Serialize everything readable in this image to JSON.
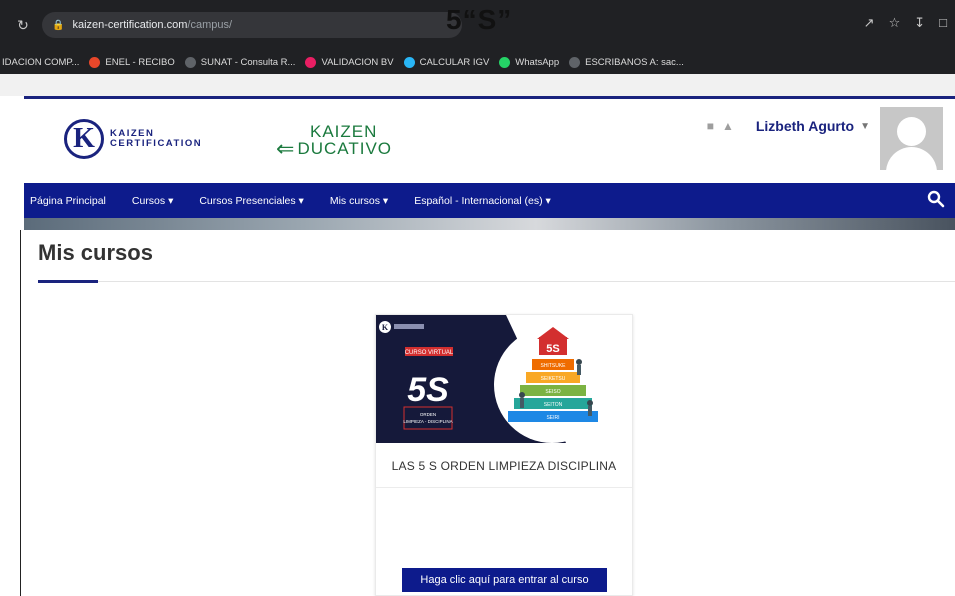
{
  "browser": {
    "url_domain": "kaizen-certification.com",
    "url_path": "/campus/",
    "document_title": "5“S”",
    "bookmarks": [
      {
        "label": "IDACION COMP...",
        "icon": "folder-icon",
        "color": "#202124"
      },
      {
        "label": "ENEL - RECIBO",
        "icon": "enel-icon",
        "color": "#e8472a"
      },
      {
        "label": "SUNAT - Consulta R...",
        "icon": "globe-icon",
        "color": "#5f6368"
      },
      {
        "label": "VALIDACION BV",
        "icon": "diamond-icon",
        "color": "#e91e63"
      },
      {
        "label": "CALCULAR IGV",
        "icon": "diamond-icon",
        "color": "#29b6f6"
      },
      {
        "label": "WhatsApp",
        "icon": "whatsapp-icon",
        "color": "#25d366"
      },
      {
        "label": "ESCRIBANOS A: sac...",
        "icon": "globe-icon",
        "color": "#5f6368"
      }
    ]
  },
  "header": {
    "logo_kaizen": {
      "line1": "KAIZEN",
      "line2": "CERTIFICATION"
    },
    "logo_educativo": {
      "line1": "KAIZEN",
      "line2": "DUCATIVO"
    },
    "user_name": "Lizbeth Agurto"
  },
  "nav": {
    "items": [
      {
        "label": "Página Principal"
      },
      {
        "label": "Cursos ▾"
      },
      {
        "label": "Cursos Presenciales ▾"
      },
      {
        "label": "Mis cursos ▾"
      },
      {
        "label": "Español - Internacional (es) ▾"
      }
    ]
  },
  "main": {
    "title": "Mis cursos",
    "course": {
      "name": "LAS 5 S ORDEN LIMPIEZA DISCIPLINA",
      "image_tag": "CURSO VIRTUAL",
      "image_big": "5S",
      "image_sub": "ORDEN\nLIMPIEZA - DISCIPLINA",
      "pyramid": [
        "5S",
        "SHITSUKE",
        "SEIKETSU",
        "SEISO",
        "SEITON",
        "SEIRI"
      ],
      "button_label": "Haga clic aquí para entrar al curso"
    }
  },
  "colors": {
    "brand_navy": "#0d1b8c",
    "brand_green": "#1b7a3e"
  }
}
